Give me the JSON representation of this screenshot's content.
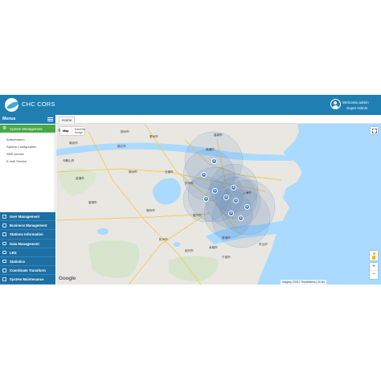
{
  "app": {
    "title": "CHC CORS",
    "user": {
      "welcome": "Welcome,admin",
      "role": "Super Admin"
    }
  },
  "sidebar": {
    "menus_title": "Menus",
    "system_management": {
      "label": "System Management",
      "items": [
        "Authorization",
        "System Configuration",
        "SMS service",
        "E-mail Service"
      ]
    },
    "nav_items": [
      {
        "label": "User Management",
        "icon": "users-icon"
      },
      {
        "label": "Business Management",
        "icon": "briefcase-icon"
      },
      {
        "label": "Stations Information",
        "icon": "station-icon"
      },
      {
        "label": "Data Management",
        "icon": "database-icon"
      },
      {
        "label": "LBS",
        "icon": "location-icon"
      },
      {
        "label": "Statistics",
        "icon": "chart-icon"
      },
      {
        "label": "Coordinate Transform",
        "icon": "transform-icon"
      },
      {
        "label": "System Maintenance",
        "icon": "wrench-icon"
      }
    ]
  },
  "tabs": {
    "home": "Home"
  },
  "map": {
    "type_map": "Map",
    "type_satellite": "Satellite Image",
    "attribution": "Imagery ©2017 TerraMetrics | 20 km",
    "google": "Google",
    "zoom_in": "+",
    "zoom_out": "−",
    "station_marker_label": "A",
    "station_count": 10,
    "cities": [
      "镇江市",
      "常州市",
      "无锡市",
      "苏州市",
      "上海市",
      "南通市",
      "湖州市",
      "嘉兴市",
      "杭州市",
      "绍兴市",
      "宁波市",
      "舟山市",
      "宣城市",
      "南京市",
      "芜湖市",
      "扬州市",
      "泰州市",
      "盐城市",
      "马鞍山市",
      "合肥市",
      "慈溪市",
      "余姚市"
    ]
  },
  "colors": {
    "header": "#1f7fb3",
    "sidebar_nav": "#1e6fa3",
    "system_management_active": "#49a845",
    "sea": "#aadaff",
    "land": "#e8e7e2",
    "station": "#3a79c0"
  }
}
